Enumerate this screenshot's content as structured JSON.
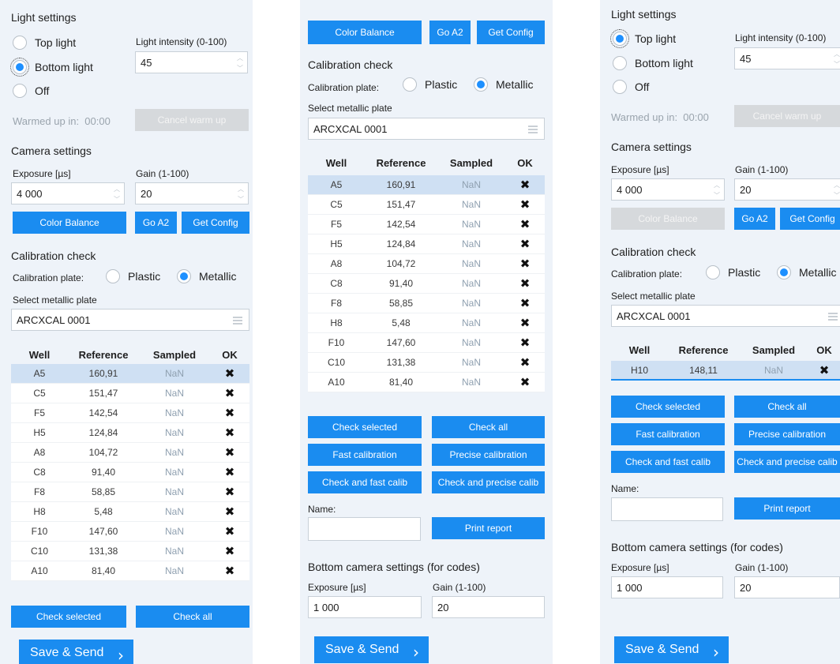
{
  "light": {
    "title": "Light settings",
    "top": "Top light",
    "bottom": "Bottom light",
    "off": "Off",
    "intensity_label": "Light intensity (0-100)",
    "intensity_value": "45",
    "warm_label": "Warmed up in:",
    "warm_time": "00:00",
    "cancel_warm": "Cancel warm up"
  },
  "camera": {
    "title": "Camera settings",
    "exposure_label": "Exposure [µs]",
    "exposure_value": "4 000",
    "gain_label": "Gain (1-100)",
    "gain_value": "20"
  },
  "buttons": {
    "color_balance": "Color Balance",
    "go_a2": "Go A2",
    "get_config": "Get Config",
    "check_selected": "Check selected",
    "check_all": "Check all",
    "fast_calibration": "Fast calibration",
    "precise_calibration": "Precise calibration",
    "check_fast": "Check and fast calib",
    "check_precise": "Check and precise calib",
    "print_report": "Print report",
    "save_send": "Save & Send",
    "save_chevron": "›"
  },
  "calib": {
    "title": "Calibration check",
    "plate_label": "Calibration plate:",
    "plastic": "Plastic",
    "metallic": "Metallic",
    "select_label": "Select metallic plate",
    "selected_plate": "ARCXCAL 0001"
  },
  "table": {
    "headers": [
      "Well",
      "Reference",
      "Sampled",
      "OK"
    ],
    "rows": [
      {
        "well": "A5",
        "ref": "160,91",
        "sampled": "NaN",
        "ok": "✖"
      },
      {
        "well": "C5",
        "ref": "151,47",
        "sampled": "NaN",
        "ok": "✖"
      },
      {
        "well": "F5",
        "ref": "142,54",
        "sampled": "NaN",
        "ok": "✖"
      },
      {
        "well": "H5",
        "ref": "124,84",
        "sampled": "NaN",
        "ok": "✖"
      },
      {
        "well": "A8",
        "ref": "104,72",
        "sampled": "NaN",
        "ok": "✖"
      },
      {
        "well": "C8",
        "ref": "91,40",
        "sampled": "NaN",
        "ok": "✖"
      },
      {
        "well": "F8",
        "ref": "58,85",
        "sampled": "NaN",
        "ok": "✖"
      },
      {
        "well": "H8",
        "ref": "5,48",
        "sampled": "NaN",
        "ok": "✖"
      },
      {
        "well": "F10",
        "ref": "147,60",
        "sampled": "NaN",
        "ok": "✖"
      },
      {
        "well": "C10",
        "ref": "131,38",
        "sampled": "NaN",
        "ok": "✖"
      },
      {
        "well": "A10",
        "ref": "81,40",
        "sampled": "NaN",
        "ok": "✖"
      }
    ],
    "single_row": {
      "well": "H10",
      "ref": "148,11",
      "sampled": "NaN",
      "ok": "✖"
    }
  },
  "name_label": "Name:",
  "bottom_cam": {
    "title": "Bottom camera settings (for codes)",
    "exposure_label": "Exposure [µs]",
    "exposure_value": "1 000",
    "gain_label": "Gain (1-100)",
    "gain_value": "20"
  },
  "colors": {
    "accent": "#1a8cf0",
    "panel_bg": "#eef3f9",
    "selected_row": "#cfe0f3",
    "disabled": "#d6d9dc"
  }
}
